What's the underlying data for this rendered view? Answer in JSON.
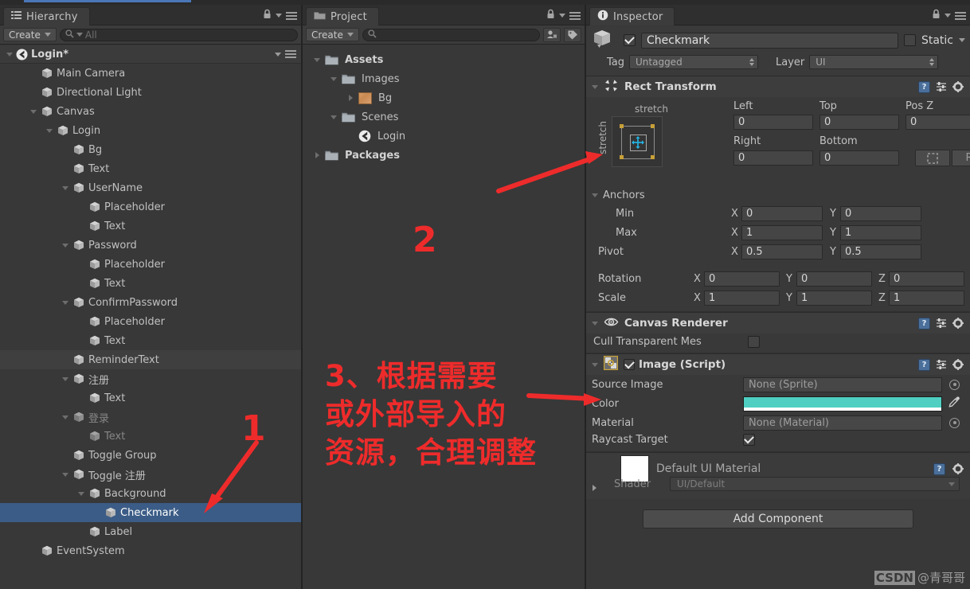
{
  "hierarchy": {
    "tab_label": "Hierarchy",
    "create_label": "Create",
    "search_placeholder": "All",
    "scene_name": "Login*",
    "items": [
      {
        "label": "Main Camera",
        "depth": 1,
        "expandable": false,
        "state": "normal"
      },
      {
        "label": "Directional Light",
        "depth": 1,
        "expandable": false,
        "state": "normal"
      },
      {
        "label": "Canvas",
        "depth": 1,
        "expandable": true,
        "state": "normal"
      },
      {
        "label": "Login",
        "depth": 2,
        "expandable": true,
        "state": "normal"
      },
      {
        "label": "Bg",
        "depth": 3,
        "expandable": false,
        "state": "normal"
      },
      {
        "label": "Text",
        "depth": 3,
        "expandable": false,
        "state": "normal"
      },
      {
        "label": "UserName",
        "depth": 3,
        "expandable": true,
        "state": "normal"
      },
      {
        "label": "Placeholder",
        "depth": 4,
        "expandable": false,
        "state": "normal"
      },
      {
        "label": "Text",
        "depth": 4,
        "expandable": false,
        "state": "normal"
      },
      {
        "label": "Password",
        "depth": 3,
        "expandable": true,
        "state": "normal"
      },
      {
        "label": "Placeholder",
        "depth": 4,
        "expandable": false,
        "state": "normal"
      },
      {
        "label": "Text",
        "depth": 4,
        "expandable": false,
        "state": "normal"
      },
      {
        "label": "ConfirmPassword",
        "depth": 3,
        "expandable": true,
        "state": "normal"
      },
      {
        "label": "Placeholder",
        "depth": 4,
        "expandable": false,
        "state": "normal"
      },
      {
        "label": "Text",
        "depth": 4,
        "expandable": false,
        "state": "normal"
      },
      {
        "label": "ReminderText",
        "depth": 3,
        "expandable": false,
        "state": "hover"
      },
      {
        "label": "注册",
        "depth": 3,
        "expandable": true,
        "state": "normal"
      },
      {
        "label": "Text",
        "depth": 4,
        "expandable": false,
        "state": "normal"
      },
      {
        "label": "登录",
        "depth": 3,
        "expandable": true,
        "state": "dim"
      },
      {
        "label": "Text",
        "depth": 4,
        "expandable": false,
        "state": "dim"
      },
      {
        "label": "Toggle Group",
        "depth": 3,
        "expandable": false,
        "state": "normal"
      },
      {
        "label": "Toggle 注册",
        "depth": 3,
        "expandable": true,
        "state": "normal"
      },
      {
        "label": "Background",
        "depth": 4,
        "expandable": true,
        "state": "normal"
      },
      {
        "label": "Checkmark",
        "depth": 5,
        "expandable": false,
        "state": "selected"
      },
      {
        "label": "Label",
        "depth": 4,
        "expandable": false,
        "state": "normal"
      },
      {
        "label": "EventSystem",
        "depth": 1,
        "expandable": false,
        "state": "normal"
      }
    ]
  },
  "project": {
    "tab_label": "Project",
    "create_label": "Create",
    "search_placeholder": "",
    "items": [
      {
        "label": "Assets",
        "depth": 0,
        "expandable": true,
        "expanded": true,
        "icon": "folder-icon",
        "bold": true
      },
      {
        "label": "Images",
        "depth": 1,
        "expandable": true,
        "expanded": true,
        "icon": "folder-icon",
        "bold": false
      },
      {
        "label": "Bg",
        "depth": 2,
        "expandable": true,
        "expanded": false,
        "icon": "texture-icon",
        "bold": false
      },
      {
        "label": "Scenes",
        "depth": 1,
        "expandable": true,
        "expanded": true,
        "icon": "folder-icon",
        "bold": false
      },
      {
        "label": "Login",
        "depth": 2,
        "expandable": false,
        "expanded": false,
        "icon": "unity-scene-icon",
        "bold": false
      },
      {
        "label": "Packages",
        "depth": 0,
        "expandable": true,
        "expanded": false,
        "icon": "folder-icon",
        "bold": true
      }
    ]
  },
  "inspector": {
    "tab_label": "Inspector",
    "object_name": "Checkmark",
    "object_enabled": true,
    "static_label": "Static",
    "static_checked": false,
    "tag_label": "Tag",
    "tag_value": "Untagged",
    "layer_label": "Layer",
    "layer_value": "UI",
    "rect_transform": {
      "title": "Rect Transform",
      "anchor_preset_top": "stretch",
      "anchor_preset_left": "stretch",
      "left_label": "Left",
      "left_value": "0",
      "top_label": "Top",
      "top_value": "0",
      "posz_label": "Pos Z",
      "posz_value": "0",
      "right_label": "Right",
      "right_value": "0",
      "bottom_label": "Bottom",
      "bottom_value": "0",
      "anchors_label": "Anchors",
      "min_label": "Min",
      "min_x": "0",
      "min_y": "0",
      "max_label": "Max",
      "max_x": "1",
      "max_y": "1",
      "pivot_label": "Pivot",
      "pivot_x": "0.5",
      "pivot_y": "0.5",
      "rotation_label": "Rotation",
      "rot_x": "0",
      "rot_y": "0",
      "rot_z": "0",
      "scale_label": "Scale",
      "scale_x": "1",
      "scale_y": "1",
      "scale_z": "1",
      "axis_x": "X",
      "axis_y": "Y",
      "axis_z": "Z"
    },
    "canvas_renderer": {
      "title": "Canvas Renderer",
      "cull_label": "Cull Transparent Mes",
      "cull_checked": false
    },
    "image_script": {
      "title": "Image (Script)",
      "enabled": true,
      "source_image_label": "Source Image",
      "source_image_value": "None (Sprite)",
      "color_label": "Color",
      "color_value": "#4ECFC1",
      "material_label": "Material",
      "material_value": "None (Material)",
      "raycast_label": "Raycast Target",
      "raycast_checked": true
    },
    "material_block": {
      "title": "Default UI Material",
      "shader_label": "Shader",
      "shader_value": "UI/Default"
    },
    "add_component_label": "Add Component"
  },
  "annotations": {
    "mark_one": "1",
    "mark_two": "2",
    "note_three_line1": "3、根据需要",
    "note_three_line2": "或外部导入的",
    "note_three_line3": "资源，合理调整",
    "color": "#ee2b2b"
  },
  "watermark": {
    "brand": "CSDN",
    "author": "@青哥哥"
  }
}
